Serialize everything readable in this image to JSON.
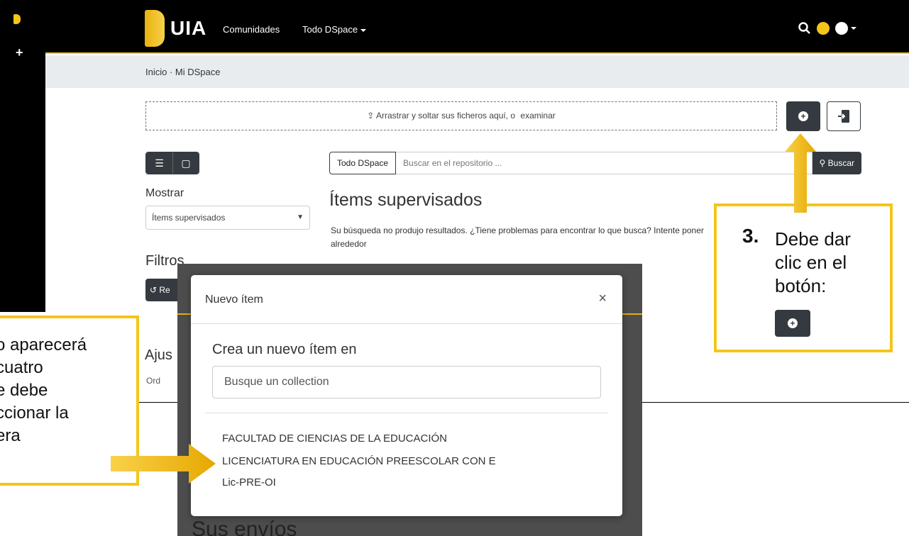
{
  "brand": {
    "name": "UIA"
  },
  "navbar": {
    "links": [
      "Comunidades",
      "Todo DSpace"
    ]
  },
  "breadcrumb": {
    "text": "Inicio · Mi DSpace"
  },
  "upload": {
    "text": "Arrastrar y soltar sus ficheros aquí, o",
    "link": "examinar"
  },
  "search": {
    "scope": "Todo DSpace",
    "placeholder": "Buscar en el repositorio ...",
    "button": "Buscar"
  },
  "sidebar": {
    "show_label": "Mostrar",
    "show_value": "Ítems supervisados",
    "filters_label": "Filtros",
    "reset_label": "Re",
    "settings_label": "Ajus",
    "order_label": "Ord"
  },
  "results": {
    "heading": "Ítems supervisados",
    "message": "Su búsqueda no produjo resultados. ¿Tiene problemas para encontrar lo que busca? Intente poner alrededor"
  },
  "modal": {
    "title": "Nuevo ítem",
    "heading": "Crea un nuevo ítem en",
    "collection_placeholder": "Busque un collection",
    "result_line1": "FACULTAD DE CIENCIAS DE LA EDUCACIÓN",
    "result_line2": "LICENCIATURA EN EDUCACIÓN PREESCOLAR CON E",
    "result_line3": "Lic-PRE-OI"
  },
  "background_text": "Sus envíos",
  "annotations": {
    "step_number": "3.",
    "step_text": [
      "Debe dar",
      "clic en el",
      "botón:"
    ],
    "left_text": [
      "o aparecerá",
      "cuatro",
      "e debe",
      "ccionar la",
      "era"
    ]
  },
  "colors": {
    "accent": "#f5c518",
    "dark": "#343a40"
  }
}
